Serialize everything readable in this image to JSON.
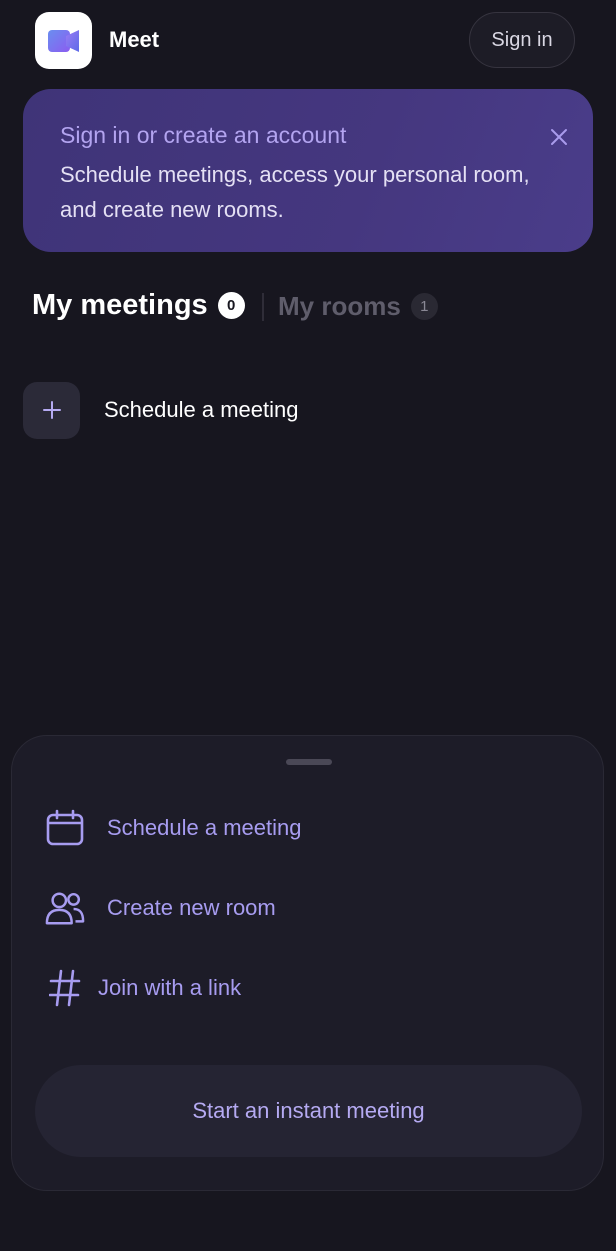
{
  "header": {
    "app_name": "Meet",
    "sign_in_label": "Sign in",
    "logo_icon": "video-camera-logo-icon"
  },
  "banner": {
    "title": "Sign in or create an account",
    "body": "Schedule meetings, access your personal room, and create new rooms.",
    "close_icon": "close-icon"
  },
  "tabs": {
    "meetings_label": "My meetings",
    "meetings_count": "0",
    "rooms_label": "My rooms",
    "rooms_count": "1",
    "active": "My meetings"
  },
  "main": {
    "schedule_label": "Schedule a meeting",
    "schedule_icon": "plus-icon"
  },
  "sheet": {
    "items": [
      {
        "label": "Schedule a meeting",
        "icon": "calendar-icon"
      },
      {
        "label": "Create new room",
        "icon": "people-icon"
      },
      {
        "label": "Join with a link",
        "icon": "hashtag-icon"
      }
    ],
    "instant_label": "Start an instant meeting"
  },
  "colors": {
    "background": "#17161f",
    "accent": "#a79cf0",
    "banner": "#45377f",
    "sheet": "#1d1c28"
  }
}
